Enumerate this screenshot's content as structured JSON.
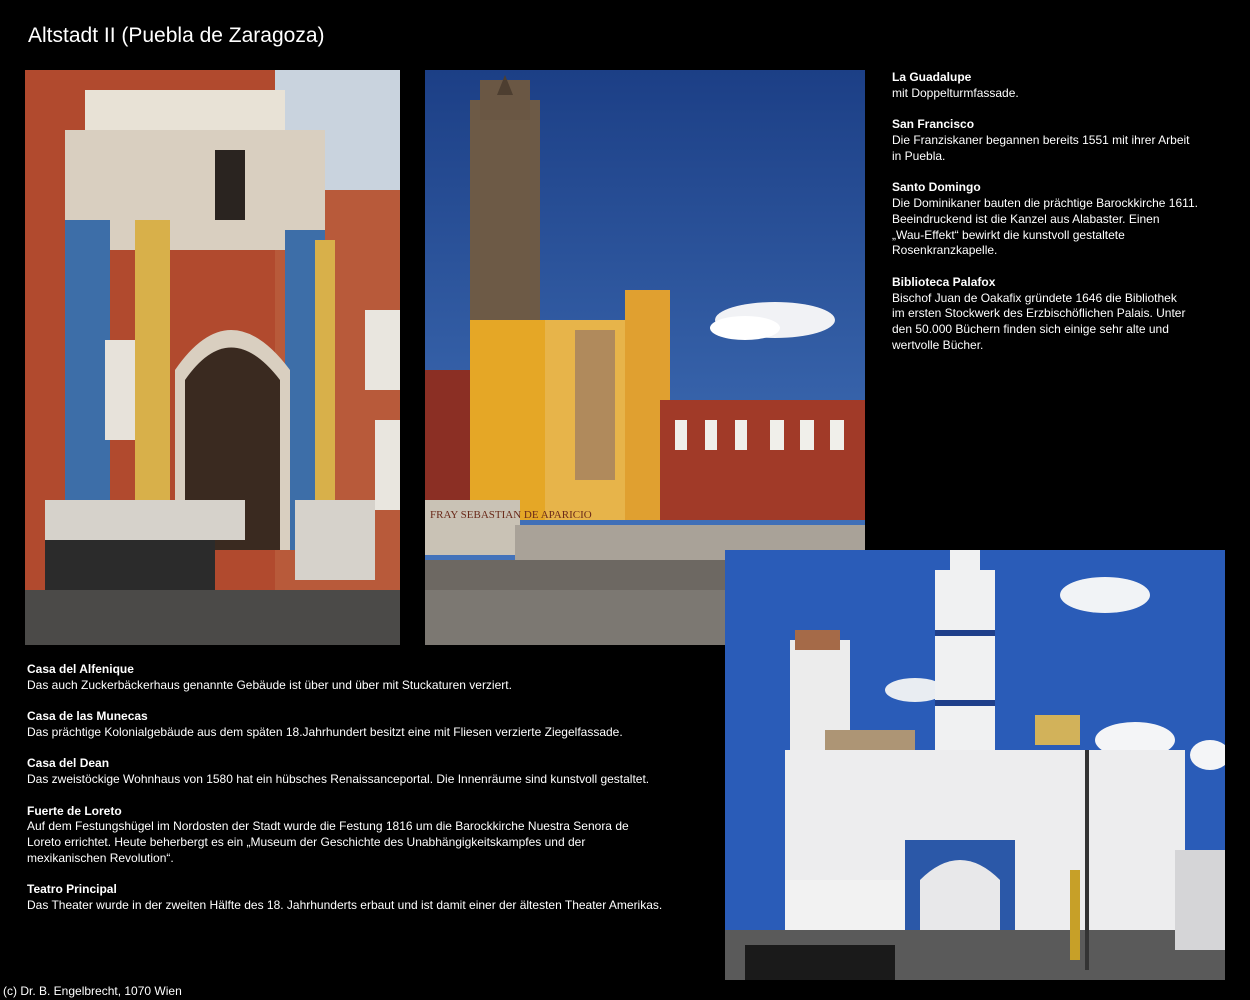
{
  "page": {
    "title": "Altstadt II (Puebla de Zaragoza)",
    "footer": "(c) Dr. B. Engelbrecht, 1070 Wien"
  },
  "photos": {
    "left": {
      "subject": "Ornate colonial church portal with tiled columns"
    },
    "middle": {
      "subject": "Santo Domingo church tower with yellow facade and steps",
      "sign_text": "FRAY SEBASTIAN DE APARICIO"
    },
    "right": {
      "subject": "White and blue church with towers (Guadalupe)"
    }
  },
  "right_column": [
    {
      "title": "La Guadalupe",
      "lines": [
        "mit Doppelturmfassade."
      ]
    },
    {
      "title": "San Francisco",
      "lines": [
        "Die Franziskaner begannen bereits 1551 mit ihrer Arbeit",
        "in Puebla."
      ]
    },
    {
      "title": "Santo Domingo",
      "lines": [
        "Die Dominikaner bauten die prächtige Barockkirche 1611.",
        "Beeindruckend ist die Kanzel aus Alabaster. Einen",
        "„Wau-Effekt“ bewirkt die kunstvoll gestaltete",
        "Rosenkranzkapelle."
      ]
    },
    {
      "title": "Biblioteca Palafox",
      "lines": [
        "Bischof Juan de Oakafix gründete 1646 die Bibliothek",
        "im ersten Stockwerk des Erzbischöflichen Palais. Unter",
        "den 50.000 Büchern finden sich einige sehr alte und",
        "wertvolle Bücher."
      ]
    }
  ],
  "bottom_column": [
    {
      "title": "Casa del Alfenique",
      "lines": [
        "Das auch Zuckerbäckerhaus genannte Gebäude ist über und über mit Stuckaturen verziert."
      ]
    },
    {
      "title": "Casa de las Munecas",
      "lines": [
        "Das prächtige Kolonialgebäude aus dem späten 18.Jahrhundert besitzt eine mit Fliesen verzierte Ziegelfassade."
      ]
    },
    {
      "title": "Casa del Dean",
      "lines": [
        "Das zweistöckige Wohnhaus von 1580 hat ein hübsches Renaissanceportal. Die Innenräume sind kunstvoll gestaltet."
      ]
    },
    {
      "title": "Fuerte de Loreto",
      "lines": [
        "Auf dem Festungshügel im Nordosten der Stadt wurde die Festung 1816 um die Barockkirche Nuestra Senora de",
        "Loreto errichtet. Heute beherbergt es ein „Museum der Geschichte des Unabhängigkeitskampfes und der",
        "mexikanischen Revolution“."
      ]
    },
    {
      "title": "Teatro Principal",
      "lines": [
        "Das Theater wurde in der zweiten Hälfte des 18. Jahrhunderts erbaut und ist damit einer der ältesten Theater Amerikas."
      ]
    }
  ]
}
